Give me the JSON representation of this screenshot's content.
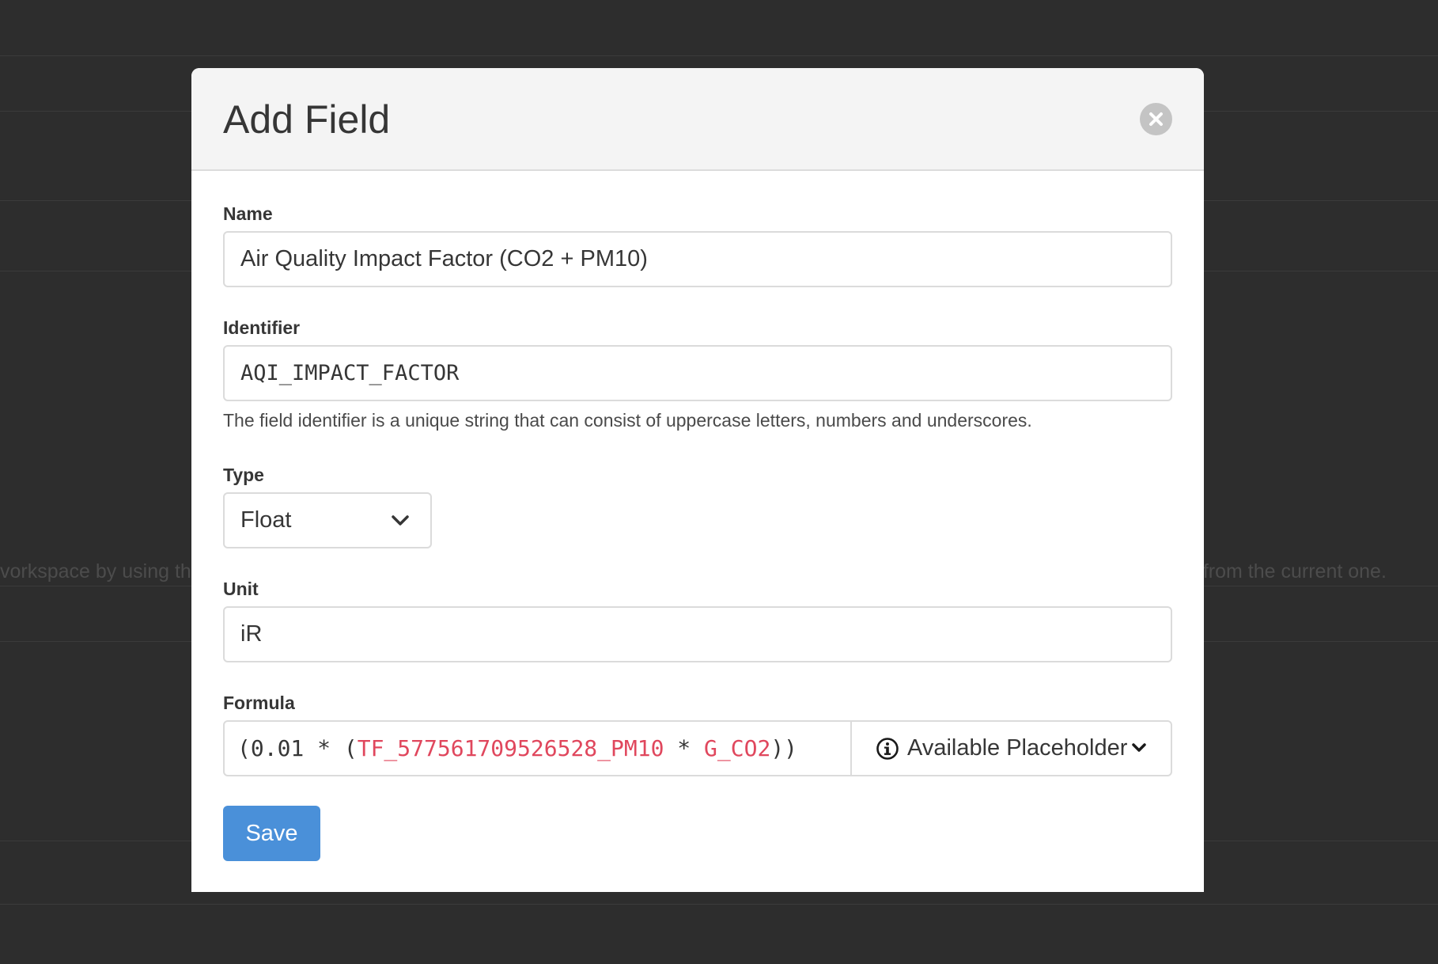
{
  "background": {
    "left_text": "vorkspace by using the",
    "right_text": "d from the current one."
  },
  "modal": {
    "title": "Add Field",
    "close_icon": "close-icon"
  },
  "form": {
    "name": {
      "label": "Name",
      "value": "Air Quality Impact Factor (CO2 + PM10)"
    },
    "identifier": {
      "label": "Identifier",
      "value": "AQI_IMPACT_FACTOR",
      "help": "The field identifier is a unique string that can consist of uppercase letters, numbers and underscores."
    },
    "type": {
      "label": "Type",
      "selected": "Float",
      "chevron_icon": "chevron-down-icon"
    },
    "unit": {
      "label": "Unit",
      "value": "iR"
    },
    "formula": {
      "label": "Formula",
      "tokens": {
        "t1": "(0.01 * (",
        "t2": "TF_577561709526528_PM10",
        "t3": " * ",
        "t4": "G_CO2",
        "t5": "))"
      },
      "placeholder_button": "Available Placeholder",
      "info_icon": "info-icon",
      "chevron_icon": "chevron-down-icon",
      "placeholder_color": "#e0475d"
    },
    "save_label": "Save",
    "save_color": "#4a90d9"
  }
}
